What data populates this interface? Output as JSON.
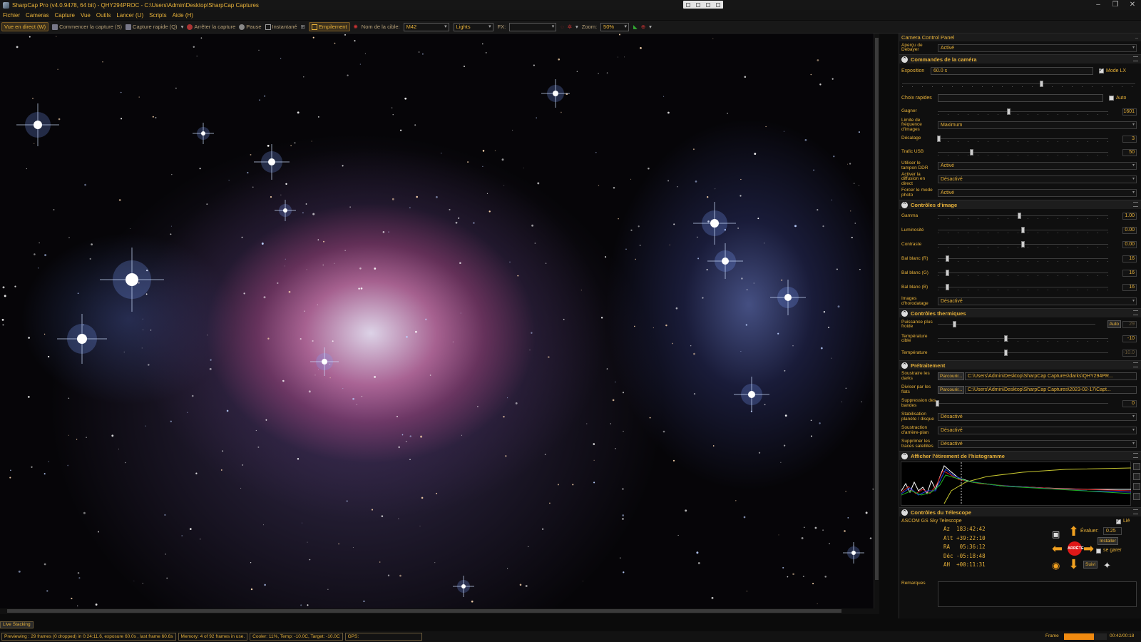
{
  "window": {
    "title": "SharpCap Pro (v4.0.9478, 64 bit) - QHY294PROC - C:\\Users\\Admin\\Desktop\\SharpCap Captures"
  },
  "menu": [
    "Fichier",
    "Cameras",
    "Capture",
    "Vue",
    "Outils",
    "Lancer (U)",
    "Scripts",
    "Aide (H)"
  ],
  "toolbar": {
    "live_view": "Vue en direct (W)",
    "start_capture": "Commencer la capture (S)",
    "quick_capture": "Capture rapide (Q)",
    "stop_capture": "Arrêter la capture",
    "pause": "Pause",
    "snapshot": "Instantané",
    "stacking": "Empilement",
    "target_label": "Nom de la cible:",
    "target_value": "M42",
    "frame_type": "Lights",
    "fx_label": "FX:",
    "fx_value": "",
    "zoom_label": "Zoom:",
    "zoom_value": "50%"
  },
  "panel": {
    "title": "Camera Control Panel",
    "debayer_label": "Aperçu de Debayer",
    "debayer_value": "Activé",
    "camera_section": "Commandes de la caméra",
    "exposure_label": "Exposition",
    "exposure_value": "60.0 s",
    "lx_mode_label": "Mode LX",
    "lx_mode_checked": true,
    "exposure_slider": 0.6,
    "quick_choices_label": "Choix rapides",
    "quick_choices_value": "",
    "auto_label": "Auto",
    "gain_label": "Gagner",
    "gain_value": "1601",
    "gain_slider": 0.42,
    "fps_limit_label": "Limite de fréquence d'images",
    "fps_limit_value": "Maximum",
    "offset_label": "Décalage",
    "offset_value": "3",
    "offset_slider": 0.01,
    "usb_label": "Trafic USB",
    "usb_value": "50",
    "usb_slider": 0.2,
    "ddr_label": "Utiliser le tampon DDR",
    "ddr_value": "Activé",
    "stream_label": "Activer la diffusion en direct",
    "stream_value": "Désactivé",
    "photo_label": "Forcer le mode photo",
    "photo_value": "Activé",
    "image_section": "Contrôles d'image",
    "gamma_label": "Gamma",
    "gamma_value": "1.00",
    "gamma_slider": 0.48,
    "brightness_label": "Luminosité",
    "brightness_value": "0.00",
    "brightness_slider": 0.5,
    "contrast_label": "Contraste",
    "contrast_value": "0.00",
    "contrast_slider": 0.5,
    "wb_r_label": "Bal blanc (R)",
    "wb_r_value": "16",
    "wb_r_slider": 0.06,
    "wb_g_label": "Bal blanc (G)",
    "wb_g_value": "16",
    "wb_g_slider": 0.06,
    "wb_b_label": "Bal blanc (B)",
    "wb_b_value": "16",
    "wb_b_slider": 0.06,
    "timestamp_label": "Images d'horodatage",
    "timestamp_value": "Désactivé",
    "thermal_section": "Contrôles thermiques",
    "cooler_label": "Puissance plus froide",
    "cooler_auto": "Auto",
    "cooler_value": "29",
    "cooler_slider": 0.11,
    "target_temp_label": "Température cible",
    "target_temp_value": "-10",
    "target_temp_slider": 0.4,
    "temp_label": "Température",
    "temp_value": "-10.0",
    "temp_slider": 0.4,
    "preprocess_section": "Prétraitement",
    "darks_label": "Soustraire les darks",
    "darks_browse": "Parcourir...",
    "darks_path": "C:\\Users\\Admin\\Desktop\\SharpCap Captures\\darks\\QHY294PR...",
    "flats_label": "Diviser par les flats",
    "flats_browse": "Parcourir...",
    "flats_path": "C:\\Users\\Admin\\Desktop\\SharpCap Captures\\2023-02-17\\Capt...",
    "banding_label": "Suppression des bandes",
    "banding_value": "0",
    "banding_slider": 0.0,
    "stab_label": "Stabilisation planète / disque",
    "stab_value": "Désactivé",
    "bg_label": "Soustraction d'arrière-plan",
    "bg_value": "Désactivé",
    "sat_label": "Supprimer les traces satellites",
    "sat_value": "Désactivé",
    "histogram_section": "Afficher l'étirement de l'histogramme",
    "telescope_section": "Contrôles du Télescope",
    "telescope_name": "ASCOM GS Sky Telescope",
    "connected_label": "Lié",
    "connected_checked": true,
    "coords": [
      {
        "label": "Az",
        "value": "183:42:42"
      },
      {
        "label": "Alt",
        "value": "+39:22:10"
      },
      {
        "label": "RA",
        "value": "05:36:12"
      },
      {
        "label": "Déc",
        "value": "-05:18:48"
      },
      {
        "label": "AH",
        "value": "+00:11:31"
      }
    ],
    "rate_label": "Évaluer:",
    "rate_value": "0.25",
    "install_label": "Installer",
    "park_label": "se garer",
    "follow_label": "Suivi",
    "stop_label": "ARRÊTE",
    "remarks_label": "Remarques"
  },
  "live_stacking_tab": "Live Stacking",
  "status": {
    "preview": "Previewing : 29 frames (0 dropped) in 0:24:11.6, exposure 60.0s , last frame 60.6s",
    "memory": "Memory: 4 of 92 frames in use.",
    "cooler": "Cooler: 11%, Temp: -10.0C, Target: -10.0C",
    "gps": "GPS:",
    "frame_label": "Frame",
    "frame_progress": 0.7,
    "frame_time": "00:42/00:18"
  }
}
